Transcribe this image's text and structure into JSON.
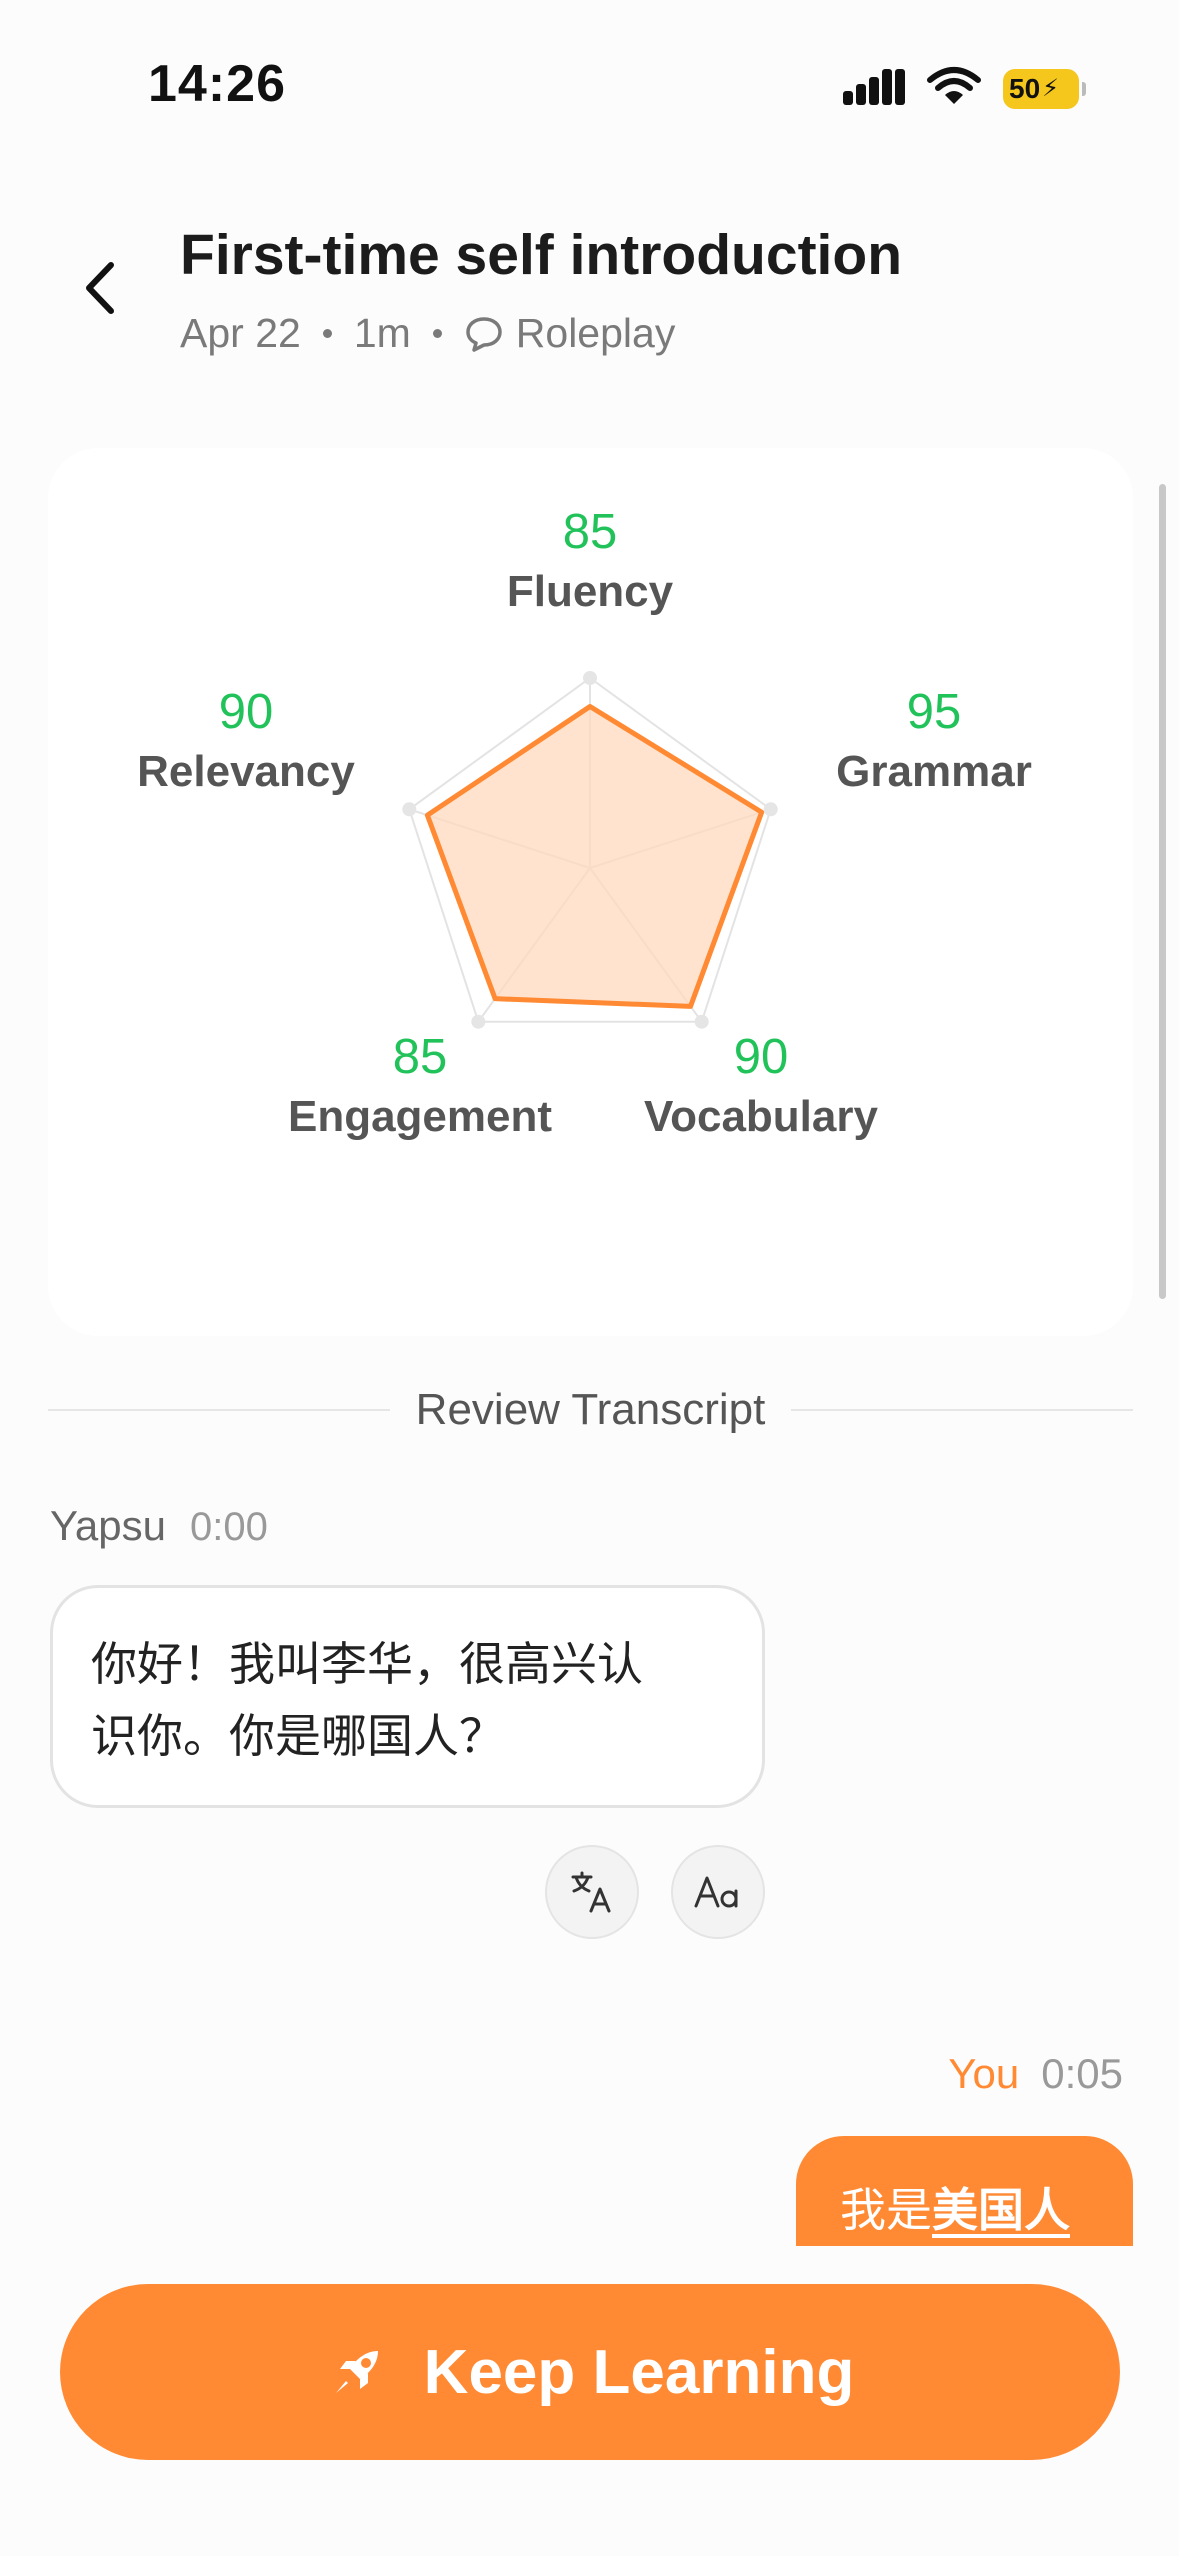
{
  "status": {
    "time": "14:26",
    "battery": "50"
  },
  "header": {
    "title": "First-time self introduction",
    "date": "Apr 22",
    "duration": "1m",
    "mode": "Roleplay"
  },
  "scores": [
    {
      "label": "Fluency",
      "score": "85"
    },
    {
      "label": "Grammar",
      "score": "95"
    },
    {
      "label": "Vocabulary",
      "score": "90"
    },
    {
      "label": "Engagement",
      "score": "85"
    },
    {
      "label": "Relevancy",
      "score": "90"
    }
  ],
  "chart_data": {
    "type": "radar",
    "categories": [
      "Fluency",
      "Grammar",
      "Vocabulary",
      "Engagement",
      "Relevancy"
    ],
    "values": [
      85,
      95,
      90,
      85,
      90
    ],
    "range": [
      0,
      100
    ],
    "rings": 5,
    "colors": {
      "line": "#ff8a33",
      "fill": "#ffd9bf",
      "grid": "#e3e3e3",
      "score": "#22c25a"
    }
  },
  "transcript": {
    "heading": "Review Transcript",
    "messages": [
      {
        "speaker": "Yapsu",
        "time": "0:00",
        "line1": "你好！我叫李华，很高兴认",
        "line2": "识你。你是哪国人？"
      },
      {
        "speaker": "You",
        "time": "0:05",
        "plain": "我是",
        "highlighted": "美国人"
      }
    ],
    "translate_icon": "translate-icon",
    "font_icon": "text-size-icon"
  },
  "cta": {
    "label": "Keep Learning",
    "icon": "rocket-icon"
  },
  "colors": {
    "accent": "#ff8a33",
    "score_green": "#22c25a",
    "battery": "#f5c61c"
  }
}
